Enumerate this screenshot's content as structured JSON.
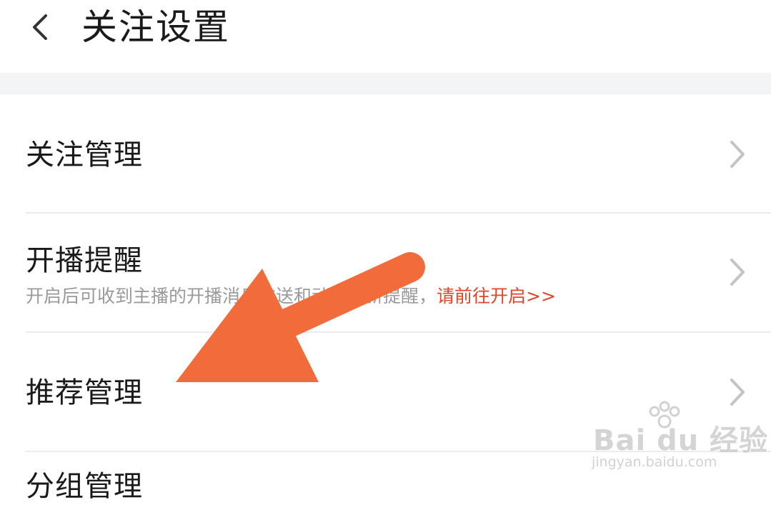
{
  "header": {
    "title": "关注设置",
    "back_icon": "chevron-left-icon"
  },
  "list": {
    "items": [
      {
        "label": "关注管理"
      },
      {
        "label": "开播提醒",
        "subtitle": "开启后可收到主播的开播消息推送和动态更新提醒，",
        "subtitle_link": "请前往开启>>"
      },
      {
        "label": "推荐管理"
      },
      {
        "label": "分组管理"
      }
    ],
    "chevron_icon": "chevron-right-icon"
  },
  "overlay": {
    "arrow_color": "#f26b3a",
    "arrow_icon": "pointer-arrow-icon"
  },
  "watermark": {
    "logo": "Bai du 经验",
    "url": "jingyan.baidu.com"
  },
  "colors": {
    "link": "#e0462a",
    "divider": "#ececec",
    "band": "#f2f4f6",
    "text": "#1a1a1a",
    "subtext": "#9a9a9a"
  }
}
